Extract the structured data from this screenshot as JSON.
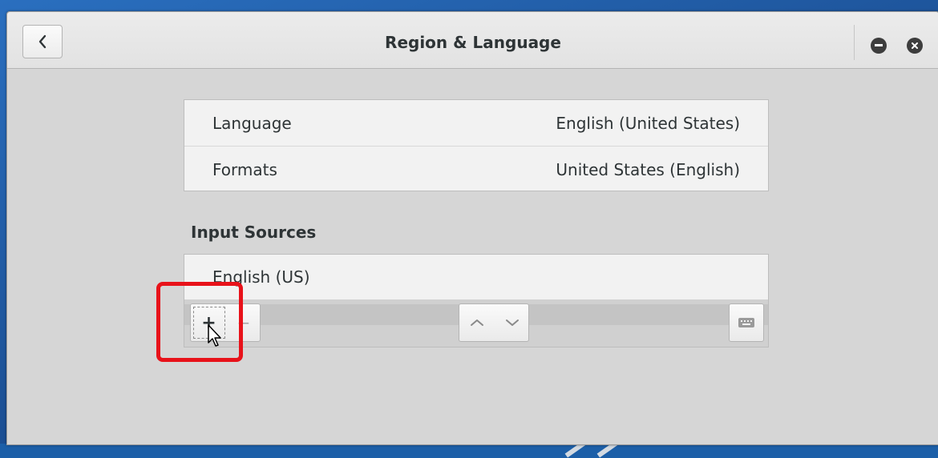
{
  "window": {
    "title": "Region & Language"
  },
  "titlebar": {
    "back_icon": "chevron-left-icon",
    "minimize_icon": "minimize-icon",
    "close_icon": "close-icon"
  },
  "locale_settings": [
    {
      "label": "Language",
      "value": "English (United States)"
    },
    {
      "label": "Formats",
      "value": "United States (English)"
    }
  ],
  "input_sources": {
    "heading": "Input Sources",
    "items": [
      {
        "label": "English (US)"
      }
    ],
    "toolbar": {
      "add_label": "+",
      "remove_label": "−",
      "move_up_icon": "chevron-up-icon",
      "move_down_icon": "chevron-down-icon",
      "keyboard_icon": "keyboard-icon"
    }
  },
  "annotation": {
    "highlight_color": "#e8121a"
  },
  "colors": {
    "desktop": "#1c5fa8",
    "window_bg": "#d6d6d6",
    "panel_bg": "#f2f2f2"
  }
}
